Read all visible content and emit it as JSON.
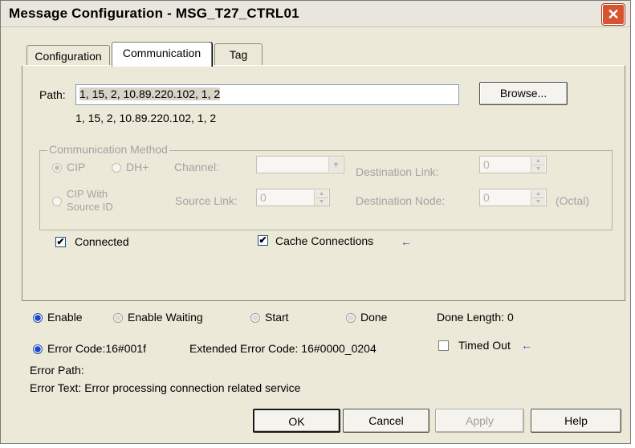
{
  "window": {
    "title": "Message Configuration - MSG_T27_CTRL01",
    "close_glyph": "✕"
  },
  "tabs": [
    {
      "label": "Configuration",
      "active": false
    },
    {
      "label": "Communication",
      "active": true
    },
    {
      "label": "Tag",
      "active": false
    }
  ],
  "path": {
    "label": "Path:",
    "value": "1, 15, 2, 10.89.220.102, 1, 2",
    "resolved": "1, 15, 2, 10.89.220.102, 1, 2",
    "browse_label": "Browse..."
  },
  "comm_method": {
    "legend": "Communication Method",
    "cip_label": "CIP",
    "dhplus_label": "DH+",
    "cip_source_label_line1": "CIP With",
    "cip_source_label_line2": "Source ID",
    "channel_label": "Channel:",
    "channel_value": "",
    "destination_link_label": "Destination Link:",
    "destination_link_value": "0",
    "source_link_label": "Source Link:",
    "source_link_value": "0",
    "destination_node_label": "Destination Node:",
    "destination_node_value": "0",
    "octal_label": "(Octal)"
  },
  "options": {
    "connected_label": "Connected",
    "connected_checked": true,
    "cache_label": "Cache Connections",
    "cache_checked": true,
    "check_glyph": "✔",
    "arrow_glyph": "←"
  },
  "status": {
    "enable_label": "Enable",
    "enable_waiting_label": "Enable Waiting",
    "start_label": "Start",
    "done_label": "Done",
    "done_length_label": "Done Length: 0",
    "error_code_label": "Error Code:16#001f",
    "extended_error_label": "Extended Error Code: 16#0000_0204",
    "timed_out_label": "Timed Out",
    "error_path_label": "Error Path:",
    "error_text_label": "Error Text: Error processing connection related service"
  },
  "buttons": {
    "ok": "OK",
    "cancel": "Cancel",
    "apply": "Apply",
    "help": "Help"
  },
  "colors": {
    "accent_blue": "#1c46d6",
    "close_red": "#d8532f",
    "dialog_bg": "#ece9d8"
  }
}
